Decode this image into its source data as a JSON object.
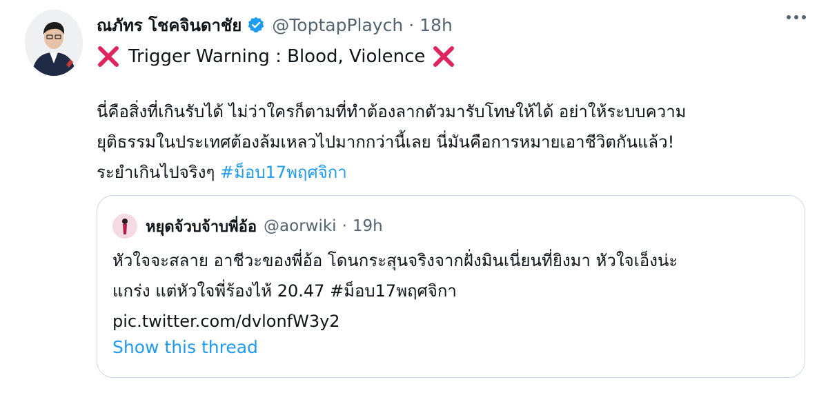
{
  "tweet": {
    "author_name": "ณภัทร โชคจินดาชัย",
    "handle": "@ToptapPlaych",
    "separator": "·",
    "time": "18h",
    "warning": "Trigger Warning : Blood, Violence",
    "body_lines": [
      "นี่คือสิ่งที่เกินรับได้ ไม่ว่าใครก็ตามที่ทำต้องลากตัวมารับโทษให้ได้ อย่าให้ระบบความ",
      "ยุติธรรมในประเทศต้องล้มเหลวไปมากกว่านี้เลย นี่มันคือการหมายเอาชีวิตกันแล้ว!",
      "ระยำเกินไปจริงๆ"
    ],
    "hashtag": "#ม็อบ17พฤศจิกา"
  },
  "quoted": {
    "author_name": "หยุดจ้วบจ้าบพี่อ้อ",
    "handle": "@aorwiki",
    "separator": "·",
    "time": "19h",
    "text_lines": [
      "หัวใจจะสลาย อาชีวะของพี่อ้อ โดนกระสุนจริงจากฝั่งมินเนี่ยนที่ยิงมา หัวใจเอ็งน่ะ",
      "แกร่ง แต่หัวใจพี่ร้องไห้ 20.47 #ม็อบ17พฤศจิกา"
    ],
    "link": "pic.twitter.com/dvlonfW3y2",
    "show_thread": "Show this thread"
  },
  "colors": {
    "accent": "#1d9bf0",
    "secondary_text": "#536471",
    "warning_x": "#e0245e"
  },
  "icons": {
    "verified": "verified-badge-icon",
    "warning": "cross-mark-icon",
    "more": "more-options-icon"
  }
}
